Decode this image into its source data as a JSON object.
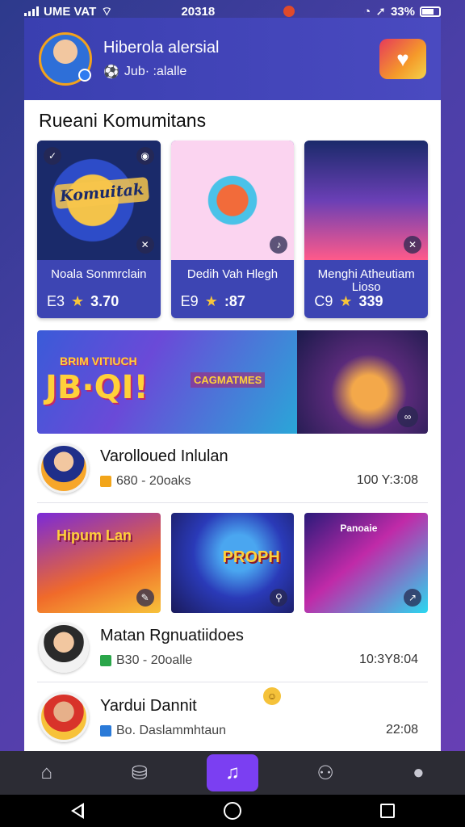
{
  "status": {
    "carrier": "UME VAT",
    "time": "20318",
    "battery": "33%"
  },
  "header": {
    "title": "Hiberola alersial",
    "subtitle": "Jub· :alalle"
  },
  "section": {
    "title": "Rueani Komumitans"
  },
  "top_cards": [
    {
      "overlay": "Komuitak",
      "name": "Noala Sonmrclain",
      "meta_code": "E3",
      "rating": "3.70"
    },
    {
      "overlay": "",
      "name": "Dedih Vah Hlegh",
      "meta_code": "E9",
      "rating": ":87"
    },
    {
      "overlay": "",
      "name": "Menghi Atheutiam Lioso",
      "meta_code": "C9",
      "rating": "339"
    }
  ],
  "banner": {
    "small": "BRIM VITIUCH",
    "big": "JB·QI!",
    "caption": "CAGMATMES"
  },
  "list_items": [
    {
      "title": "Varolloued Inlulan",
      "sub": "680 - 20oaks",
      "time": "100 Y:3:08",
      "icon_color": "#f2a51a"
    },
    {
      "title": "Matan Rgnuatiidoes",
      "sub": "B30 - 20oalle",
      "time": "10:3Y8:04",
      "icon_color": "#2aa64a"
    },
    {
      "title": "Yardui Dannit",
      "sub": "Bo. Daslammhtaun",
      "time": "22:08",
      "icon_color": "#2a7ad8"
    }
  ],
  "mid_cards": [
    {
      "tag": "Hipum Lan",
      "tag2": ""
    },
    {
      "tag": "",
      "tag2": "PROPH"
    },
    {
      "tag": "Panoaie",
      "tag2": ""
    }
  ],
  "colors": {
    "header": "#3a3fb0",
    "card": "#3d45b3",
    "star": "#f7c53b",
    "nav_active": "#7b3ff2"
  },
  "icons": {
    "nav": [
      "home-icon",
      "box-icon",
      "music-icon",
      "profile-outline-icon",
      "user-icon"
    ]
  }
}
